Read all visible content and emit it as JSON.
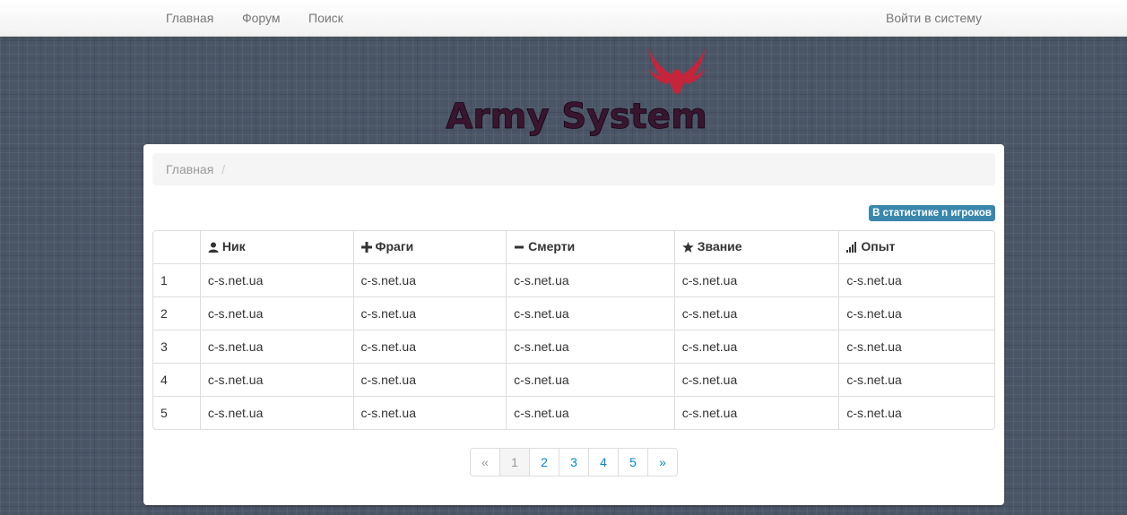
{
  "nav": {
    "home": "Главная",
    "forum": "Форум",
    "search": "Поиск",
    "login": "Войти в систему"
  },
  "logo": {
    "text": "Army System",
    "icon": "phoenix-icon",
    "color": "#c4253a"
  },
  "breadcrumb": {
    "home": "Главная",
    "divider": "/"
  },
  "badge": "В статистике n игроков",
  "table": {
    "columns": [
      {
        "label": "",
        "icon": ""
      },
      {
        "label": "Ник",
        "icon": "user-icon"
      },
      {
        "label": "Фраги",
        "icon": "plus-icon"
      },
      {
        "label": "Смерти",
        "icon": "minus-icon"
      },
      {
        "label": "Звание",
        "icon": "star-icon"
      },
      {
        "label": "Опыт",
        "icon": "signal-icon"
      }
    ],
    "rows": [
      [
        "1",
        "c-s.net.ua",
        "c-s.net.ua",
        "c-s.net.ua",
        "c-s.net.ua",
        "c-s.net.ua"
      ],
      [
        "2",
        "c-s.net.ua",
        "c-s.net.ua",
        "c-s.net.ua",
        "c-s.net.ua",
        "c-s.net.ua"
      ],
      [
        "3",
        "c-s.net.ua",
        "c-s.net.ua",
        "c-s.net.ua",
        "c-s.net.ua",
        "c-s.net.ua"
      ],
      [
        "4",
        "c-s.net.ua",
        "c-s.net.ua",
        "c-s.net.ua",
        "c-s.net.ua",
        "c-s.net.ua"
      ],
      [
        "5",
        "c-s.net.ua",
        "c-s.net.ua",
        "c-s.net.ua",
        "c-s.net.ua",
        "c-s.net.ua"
      ]
    ]
  },
  "pagination": {
    "prev": "«",
    "pages": [
      "1",
      "2",
      "3",
      "4",
      "5"
    ],
    "current": "1",
    "next": "»"
  },
  "colors": {
    "link": "#0088cc",
    "badge": "#3a87ad",
    "background": "#4a5566"
  }
}
